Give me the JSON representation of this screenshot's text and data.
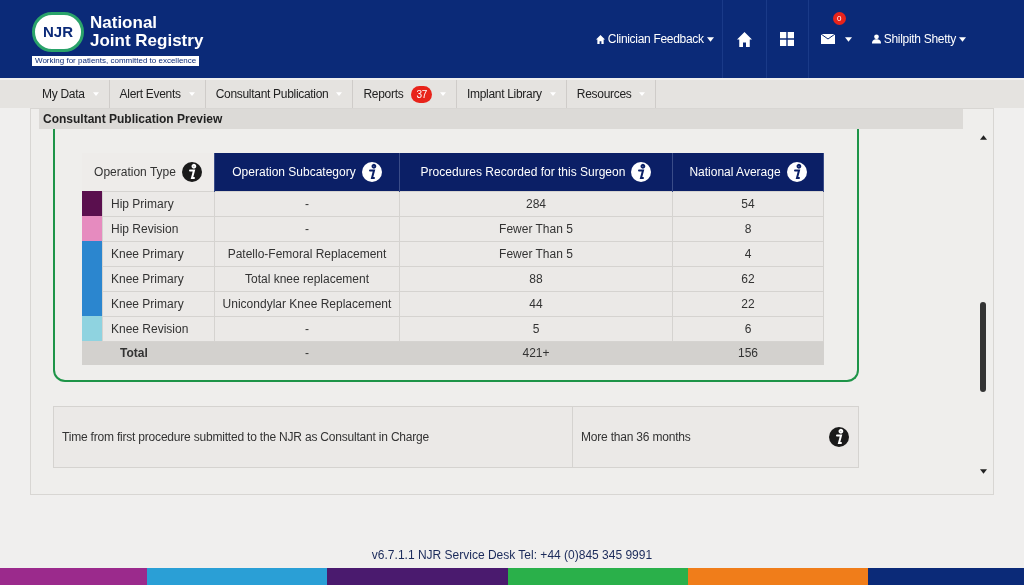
{
  "header": {
    "logo_mark": "NJR",
    "logo_title_line1": "National",
    "logo_title_line2": "Joint Registry",
    "tagline": "Working for patients, committed to excellence",
    "clinician_feedback": "Clinician Feedback",
    "messages_badge": "0",
    "user_name": "Shilpith Shetty"
  },
  "nav": [
    {
      "label": "My Data"
    },
    {
      "label": "Alert Events"
    },
    {
      "label": "Consultant Publication"
    },
    {
      "label": "Reports",
      "badge": "37"
    },
    {
      "label": "Implant Library"
    },
    {
      "label": "Resources"
    }
  ],
  "panel_title": "Consultant Publication Preview",
  "table": {
    "columns": [
      {
        "label": "Operation Type",
        "highlighted": false
      },
      {
        "label": "Operation Subcategory",
        "highlighted": true
      },
      {
        "label": "Procedures Recorded for this Surgeon",
        "highlighted": true
      },
      {
        "label": "National Average",
        "highlighted": true
      }
    ],
    "rows": [
      {
        "color": "#5a0f4e",
        "cells": [
          "Hip Primary",
          "-",
          "284",
          "54"
        ]
      },
      {
        "color": "#e68bbf",
        "cells": [
          "Hip Revision",
          "-",
          "Fewer Than 5",
          "8"
        ]
      },
      {
        "color": "#2b86cf",
        "cells": [
          "Knee Primary",
          "Patello-Femoral Replacement",
          "Fewer Than 5",
          "4"
        ]
      },
      {
        "color": "#2b86cf",
        "cells": [
          "Knee Primary",
          "Total knee replacement",
          "88",
          "62"
        ]
      },
      {
        "color": "#2b86cf",
        "cells": [
          "Knee Primary",
          "Unicondylar Knee Replacement",
          "44",
          "22"
        ]
      },
      {
        "color": "#8fd3e0",
        "cells": [
          "Knee Revision",
          "-",
          "5",
          "6"
        ]
      }
    ],
    "total": [
      "Total",
      "-",
      "421+",
      "156"
    ]
  },
  "info_row": {
    "label": "Time from first procedure submitted to the NJR as Consultant in Charge",
    "value": "More than 36 months"
  },
  "footer": "v6.7.1.1 NJR Service Desk Tel: +44 (0)845 345 9991"
}
